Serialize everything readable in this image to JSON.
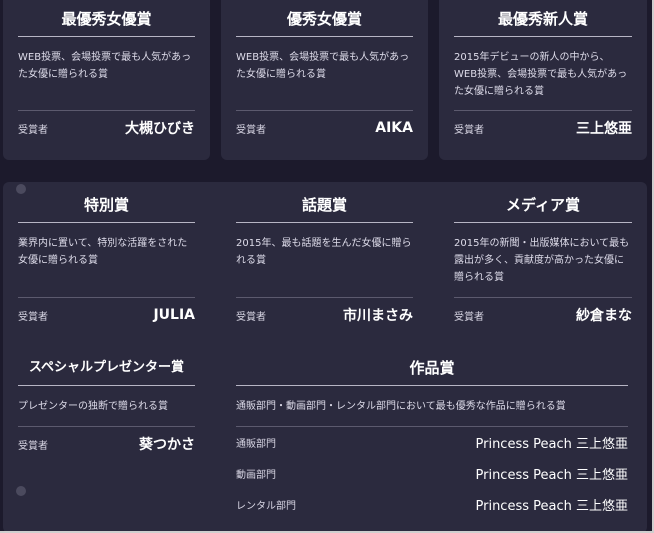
{
  "common": {
    "winner_label": "受賞者"
  },
  "awards_top": [
    {
      "title": "最優秀女優賞",
      "description": "WEB投票、会場投票で最も人気があった女優に贈られる賞",
      "winner": "大槻ひびき"
    },
    {
      "title": "優秀女優賞",
      "description": "WEB投票、会場投票で最も人気があった女優に贈られる賞",
      "winner": "AIKA"
    },
    {
      "title": "最優秀新人賞",
      "description": "2015年デビューの新人の中から、WEB投票、会場投票で最も人気があった女優に贈られる賞",
      "winner": "三上悠亜"
    }
  ],
  "awards_mid": [
    {
      "title": "特別賞",
      "description": "業界内に置いて、特別な活躍をされた女優に贈られる賞",
      "winner": "JULIA"
    },
    {
      "title": "話題賞",
      "description": "2015年、最も話題を生んだ女優に贈られる賞",
      "winner": "市川まさみ"
    },
    {
      "title": "メディア賞",
      "description": "2015年の新聞・出版媒体において最も露出が多く、貢献度が高かった女優に贈られる賞",
      "winner": "紗倉まな"
    }
  ],
  "special_presenter": {
    "title": "スペシャルプレゼンター賞",
    "description": "プレゼンターの独断で贈られる賞",
    "winner": "葵つかさ"
  },
  "sakuhin": {
    "title": "作品賞",
    "description": "通販部門・動画部門・レンタル部門において最も優秀な作品に贈られる賞",
    "rows": [
      {
        "category": "通販部門",
        "work": "Princess Peach 三上悠亜"
      },
      {
        "category": "動画部門",
        "work": "Princess Peach 三上悠亜"
      },
      {
        "category": "レンタル部門",
        "work": "Princess Peach 三上悠亜"
      }
    ]
  }
}
